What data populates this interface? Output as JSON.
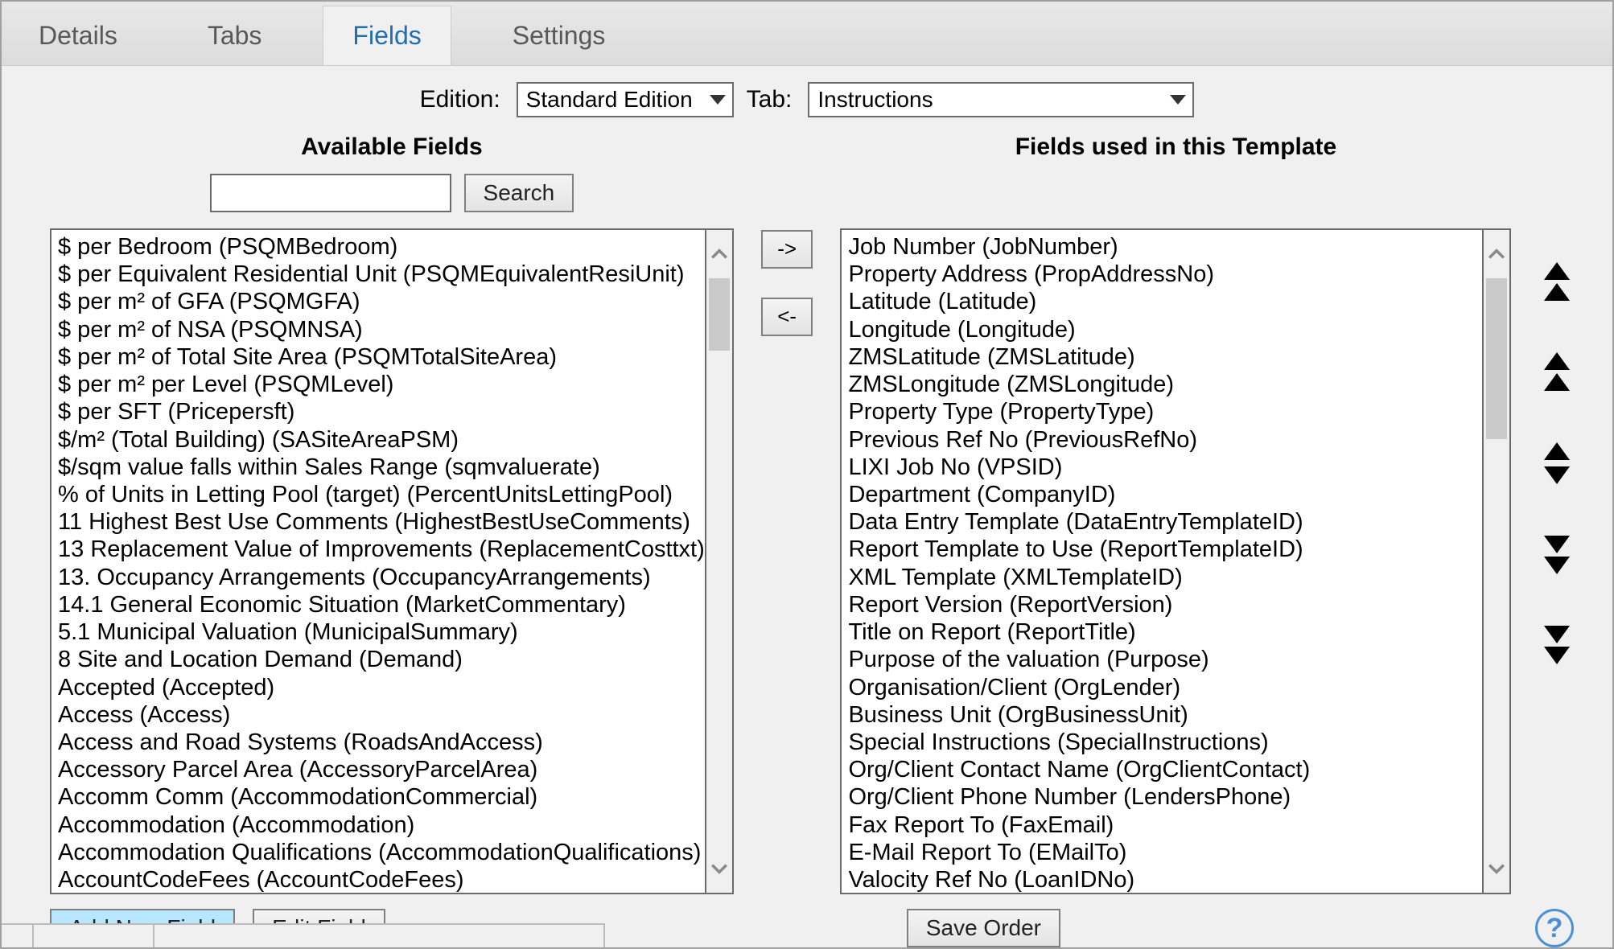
{
  "tabs": {
    "details": "Details",
    "tabs": "Tabs",
    "fields": "Fields",
    "settings": "Settings"
  },
  "filters": {
    "edition_label": "Edition:",
    "edition_value": "Standard Edition",
    "tab_label": "Tab:",
    "tab_value": "Instructions"
  },
  "left": {
    "title": "Available Fields",
    "search_button": "Search",
    "items": [
      "$ per Bedroom (PSQMBedroom)",
      "$ per Equivalent Residential Unit (PSQMEquivalentResiUnit)",
      "$ per m² of GFA (PSQMGFA)",
      "$ per m² of NSA (PSQMNSA)",
      "$ per m² of Total Site Area (PSQMTotalSiteArea)",
      "$ per m² per Level (PSQMLevel)",
      "$ per SFT (Pricepersft)",
      "$/m² (Total Building) (SASiteAreaPSM)",
      "$/sqm value falls within Sales Range (sqmvaluerate)",
      "% of Units in Letting Pool (target) (PercentUnitsLettingPool)",
      "11 Highest Best Use Comments (HighestBestUseComments)",
      "13 Replacement Value of Improvements (ReplacementCosttxt)",
      "13. Occupancy Arrangements (OccupancyArrangements)",
      "14.1 General Economic Situation (MarketCommentary)",
      "5.1 Municipal Valuation (MunicipalSummary)",
      "8 Site and Location Demand (Demand)",
      "Accepted (Accepted)",
      "Access (Access)",
      "Access and Road Systems (RoadsAndAccess)",
      "Accessory Parcel Area (AccessoryParcelArea)",
      "Accomm Comm (AccommodationCommercial)",
      "Accommodation (Accommodation)",
      "Accommodation Qualifications (AccommodationQualifications)",
      "AccountCodeFees (AccountCodeFees)"
    ]
  },
  "middle": {
    "add_label": "->",
    "remove_label": "<-"
  },
  "right": {
    "title": "Fields used in this Template",
    "items": [
      "Job Number (JobNumber)",
      "Property Address (PropAddressNo)",
      "Latitude (Latitude)",
      "Longitude (Longitude)",
      "ZMSLatitude (ZMSLatitude)",
      "ZMSLongitude (ZMSLongitude)",
      "Property Type (PropertyType)",
      "Previous Ref No (PreviousRefNo)",
      "LIXI Job No (VPSID)",
      "Department (CompanyID)",
      "Data Entry Template (DataEntryTemplateID)",
      "Report Template to Use (ReportTemplateID)",
      "XML Template (XMLTemplateID)",
      "Report Version (ReportVersion)",
      "Title on Report (ReportTitle)",
      "Purpose of the valuation (Purpose)",
      "Organisation/Client (OrgLender)",
      "Business Unit (OrgBusinessUnit)",
      "Special Instructions (SpecialInstructions)",
      "Org/Client Contact Name (OrgClientContact)",
      "Org/Client Phone Number (LendersPhone)",
      "Fax Report To (FaxEmail)",
      "E-Mail Report To (EMailTo)",
      "Valocity Ref No (LoanIDNo)"
    ]
  },
  "buttons": {
    "add_new_field": "Add New Field",
    "edit_field": "Edit Field",
    "save_order": "Save Order"
  }
}
